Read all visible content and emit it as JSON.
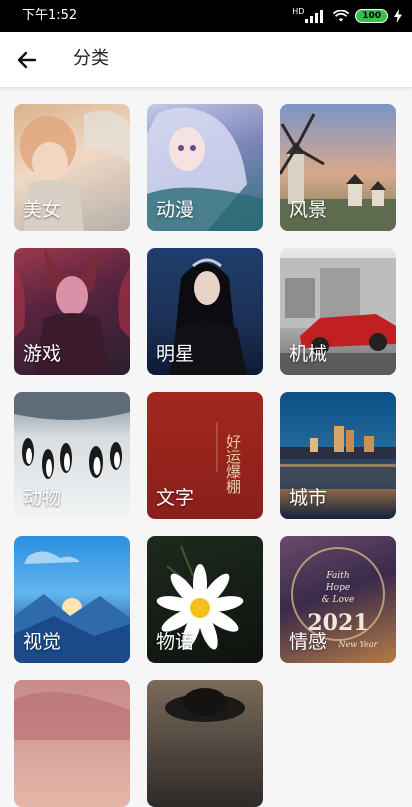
{
  "status_bar": {
    "time": "下午1:52",
    "network": "HD",
    "battery": "100"
  },
  "app_bar": {
    "back_icon": "arrow-left-icon",
    "title": "分类"
  },
  "categories": [
    {
      "label": "美女"
    },
    {
      "label": "动漫"
    },
    {
      "label": "风景"
    },
    {
      "label": "游戏"
    },
    {
      "label": "明星"
    },
    {
      "label": "机械"
    },
    {
      "label": "动物"
    },
    {
      "label": "文字"
    },
    {
      "label": "城市"
    },
    {
      "label": "视觉"
    },
    {
      "label": "物语"
    },
    {
      "label": "情感"
    },
    {
      "label": ""
    },
    {
      "label": ""
    }
  ],
  "thumbnails": {
    "text_card_1": "好运爆棚",
    "emotion_card_1": "Faith",
    "emotion_card_2": "Hope",
    "emotion_card_3": "& Love",
    "emotion_card_4": "2021",
    "emotion_card_5": "New Year"
  },
  "colors": {
    "status_bar_bg": "#000000",
    "app_bar_bg": "#ffffff",
    "page_bg": "#f6f6f6",
    "battery_green": "#35c24a"
  }
}
